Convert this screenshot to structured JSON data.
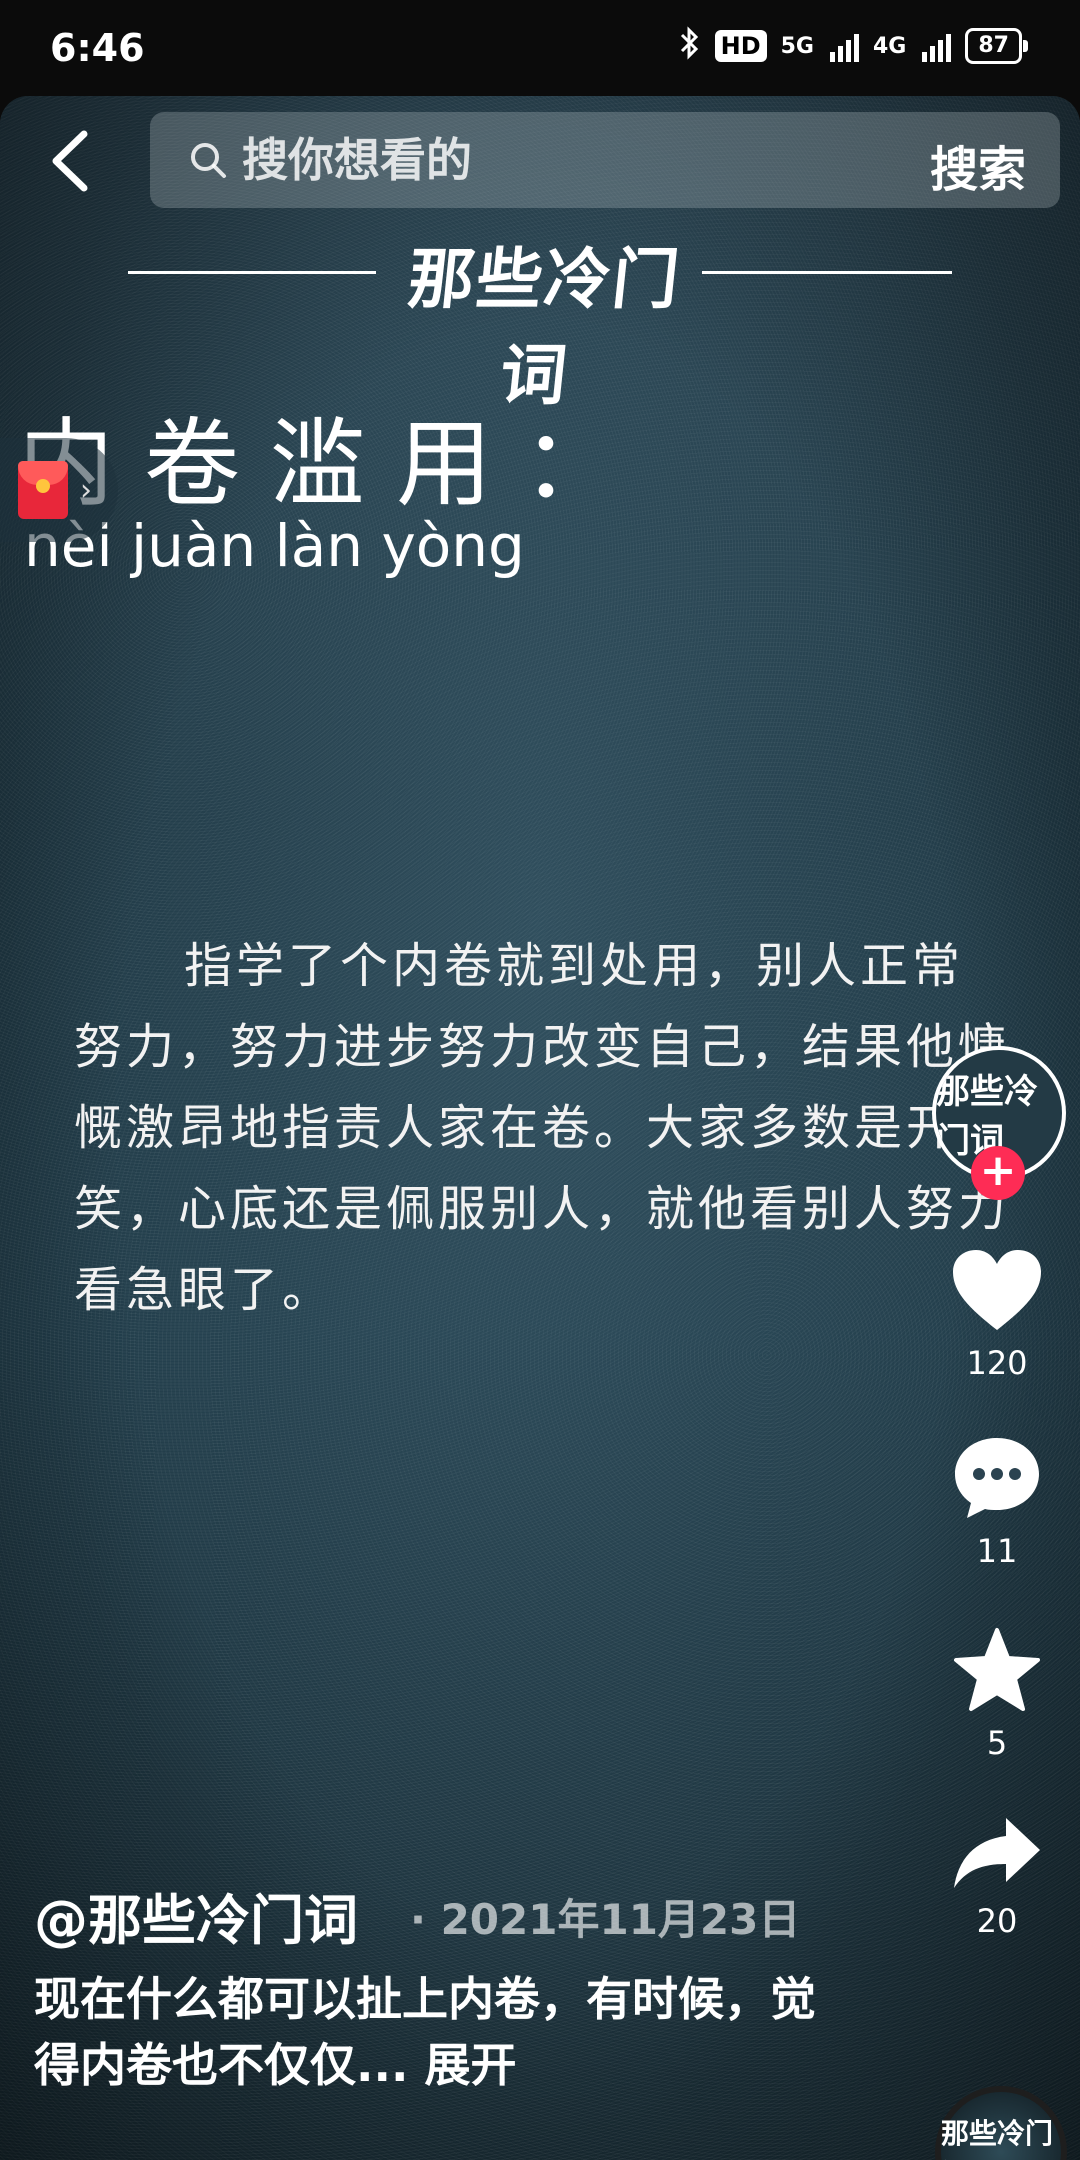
{
  "status_bar": {
    "time": "6:46",
    "hd": "HD",
    "net_5g": "5G",
    "net_4g": "4G",
    "battery": "87"
  },
  "search": {
    "placeholder": "搜你想看的",
    "button_label": "搜索"
  },
  "video": {
    "logo": "那些冷门词",
    "headword": "内卷滥用：",
    "pinyin": "nèi juàn làn yòng",
    "definition": "指学了个内卷就到处用，别人正常努力，努力进步努力改变自己，结果他慷慨激昂地指责人家在卷。大家多数是开玩笑，心底还是佩服别人，就他看别人努力看急眼了。"
  },
  "rail": {
    "avatar_text": "那些冷门词",
    "likes": "120",
    "comments": "11",
    "favorites": "5",
    "shares": "20"
  },
  "post": {
    "author": "@那些冷门词",
    "date": "· 2021年11月23日",
    "caption": "现在什么都可以扯上内卷，有时候，觉得内卷也不仅仅...",
    "expand_label": "展开",
    "music_disc_text": "那些冷门词"
  },
  "colors": {
    "follow_accent": "#fe2c55",
    "background": "#1f3844"
  }
}
